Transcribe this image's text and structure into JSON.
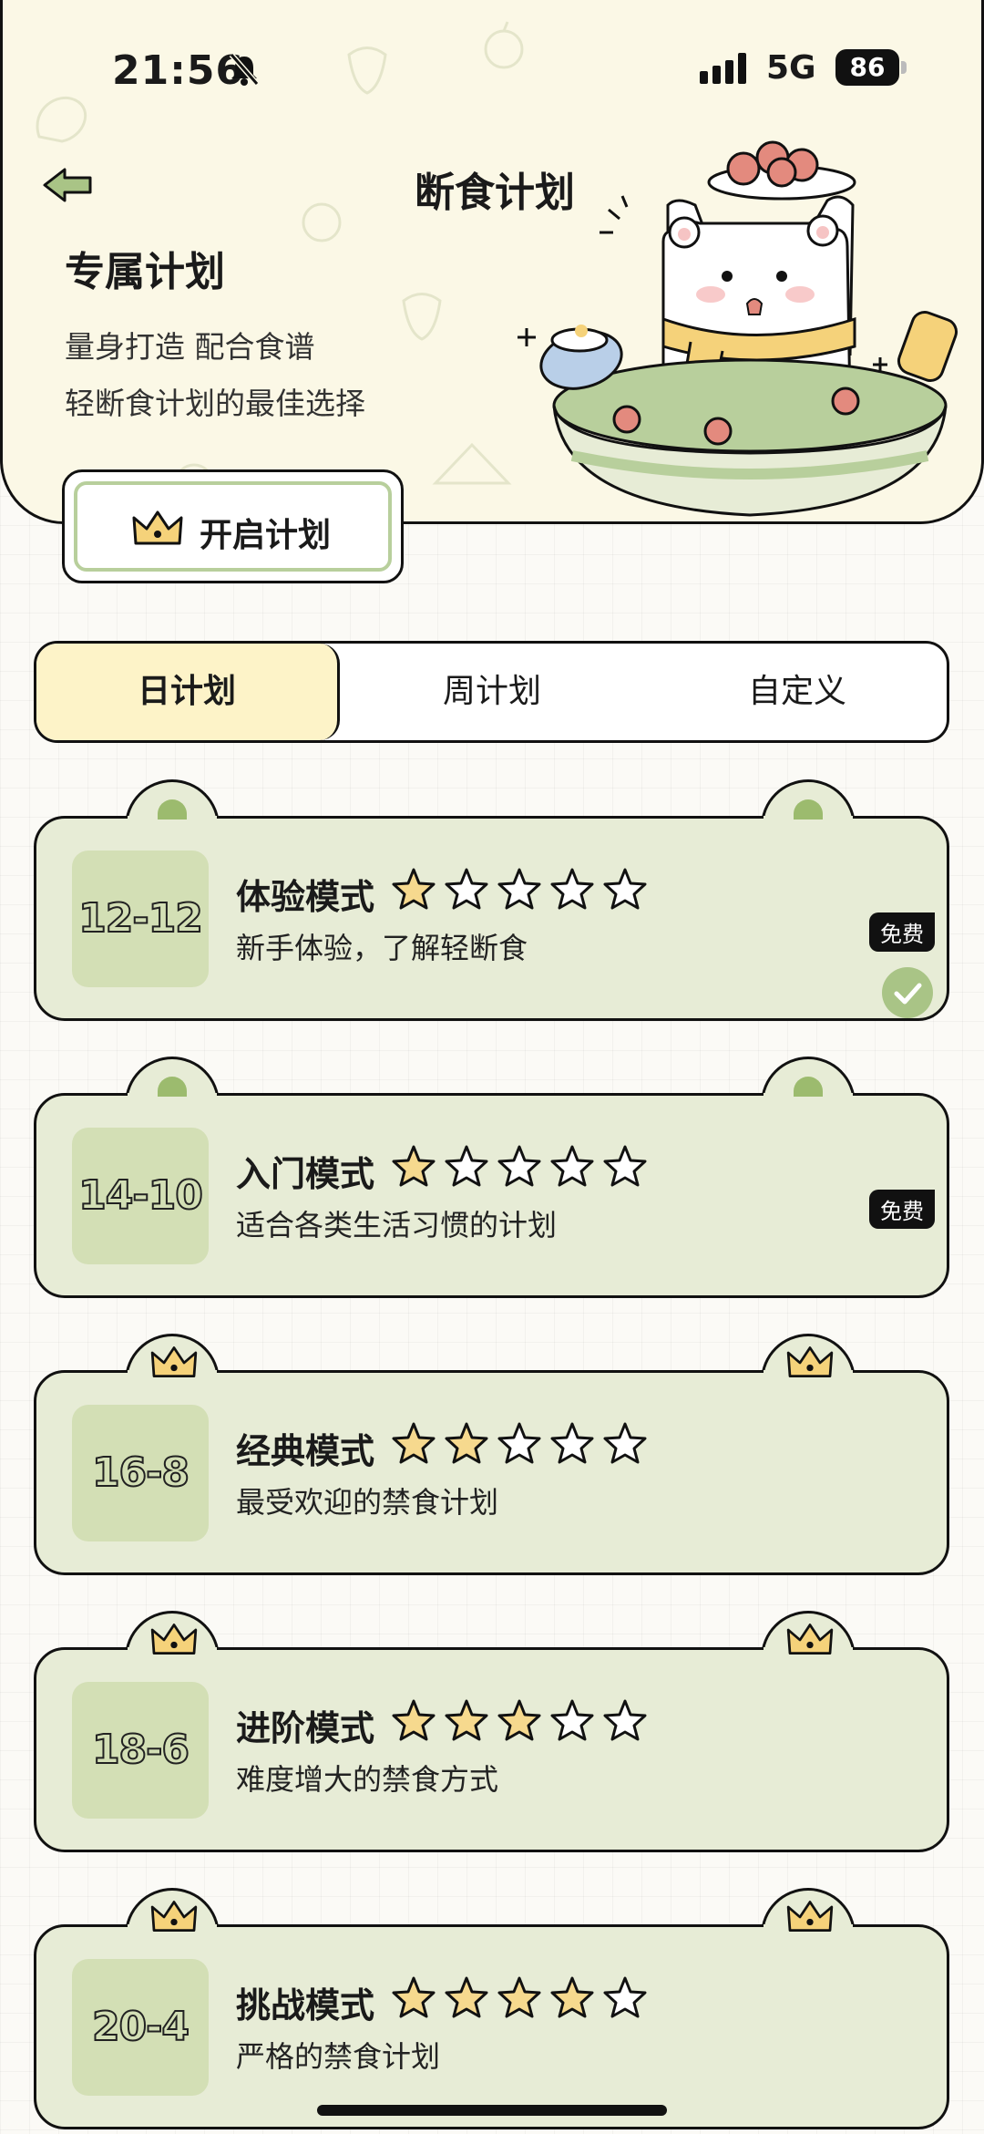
{
  "status_bar": {
    "time": "21:56",
    "network": "5G",
    "battery": "86"
  },
  "header": {
    "title": "断食计划",
    "plan_heading": "专属计划",
    "tagline_line1": "量身打造 配合食谱",
    "tagline_line2": "轻断食计划的最佳选择",
    "start_button_label": "开启计划"
  },
  "tabs": [
    {
      "label": "日计划",
      "active": true
    },
    {
      "label": "周计划",
      "active": false
    },
    {
      "label": "自定义",
      "active": false
    }
  ],
  "plans": [
    {
      "ratio": "12-12",
      "name": "体验模式",
      "desc": "新手体验，了解轻断食",
      "stars": 1,
      "badge": "免费",
      "selected": true,
      "premium": false
    },
    {
      "ratio": "14-10",
      "name": "入门模式",
      "desc": "适合各类生活习惯的计划",
      "stars": 1,
      "badge": "免费",
      "selected": false,
      "premium": false
    },
    {
      "ratio": "16-8",
      "name": "经典模式",
      "desc": "最受欢迎的禁食计划",
      "stars": 2,
      "badge": "",
      "selected": false,
      "premium": true
    },
    {
      "ratio": "18-6",
      "name": "进阶模式",
      "desc": "难度增大的禁食方式",
      "stars": 3,
      "badge": "",
      "selected": false,
      "premium": true
    },
    {
      "ratio": "20-4",
      "name": "挑战模式",
      "desc": "严格的禁食计划",
      "stars": 4,
      "badge": "",
      "selected": false,
      "premium": true
    }
  ],
  "colors": {
    "accent_green": "#9cbb6e",
    "card_bg": "#e7ecd6",
    "tab_active": "#fdf3c8",
    "star_fill": "#f6d98e"
  }
}
